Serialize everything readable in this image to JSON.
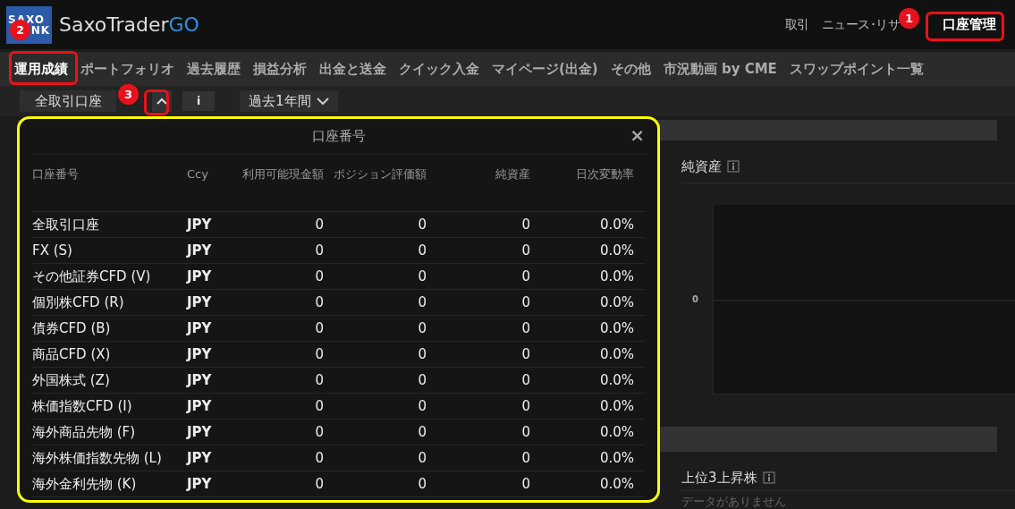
{
  "header": {
    "logo": [
      "SAXO",
      "NK"
    ],
    "app_name": "SaxoTrader",
    "app_name_accent": "GO",
    "nav": [
      {
        "label": "取引",
        "selected": false
      },
      {
        "label": "ニュース･リサ",
        "selected": false
      },
      {
        "label": "口座管理",
        "selected": true
      }
    ]
  },
  "tabs": [
    {
      "label": "運用成績",
      "selected": true
    },
    {
      "label": "ポートフォリオ",
      "selected": false
    },
    {
      "label": "過去履歴",
      "selected": false
    },
    {
      "label": "損益分析",
      "selected": false
    },
    {
      "label": "出金と送金",
      "selected": false
    },
    {
      "label": "クイック入金",
      "selected": false
    },
    {
      "label": "マイページ(出金)",
      "selected": false
    },
    {
      "label": "その他",
      "selected": false
    },
    {
      "label": "市況動画 by CME",
      "selected": false
    },
    {
      "label": "スワップポイント一覧",
      "selected": false
    }
  ],
  "filters": {
    "account": "全取引口座",
    "info": "i",
    "period": "過去1年間"
  },
  "modal": {
    "title": "口座番号",
    "close": "×",
    "columns": [
      "口座番号",
      "Ccy",
      "利用可能現金額",
      "ポジション評価額",
      "純資産",
      "日次変動率"
    ],
    "rows": [
      [
        "全取引口座",
        "JPY",
        "0",
        "0",
        "0",
        "0.0%"
      ],
      [
        "FX (S)",
        "JPY",
        "0",
        "0",
        "0",
        "0.0%"
      ],
      [
        "その他証券CFD (V)",
        "JPY",
        "0",
        "0",
        "0",
        "0.0%"
      ],
      [
        "個別株CFD (R)",
        "JPY",
        "0",
        "0",
        "0",
        "0.0%"
      ],
      [
        "債券CFD (B)",
        "JPY",
        "0",
        "0",
        "0",
        "0.0%"
      ],
      [
        "商品CFD (X)",
        "JPY",
        "0",
        "0",
        "0",
        "0.0%"
      ],
      [
        "外国株式 (Z)",
        "JPY",
        "0",
        "0",
        "0",
        "0.0%"
      ],
      [
        "株価指数CFD (I)",
        "JPY",
        "0",
        "0",
        "0",
        "0.0%"
      ],
      [
        "海外商品先物 (F)",
        "JPY",
        "0",
        "0",
        "0",
        "0.0%"
      ],
      [
        "海外株価指数先物 (L)",
        "JPY",
        "0",
        "0",
        "0",
        "0.0%"
      ],
      [
        "海外金利先物 (K)",
        "JPY",
        "0",
        "0",
        "0",
        "0.0%"
      ]
    ]
  },
  "panels": [
    {
      "title": "純資産",
      "y_label": "0"
    },
    {
      "title": "上位3上昇株",
      "empty_text": "データがありません"
    }
  ],
  "annotations": [
    {
      "number": "1"
    },
    {
      "number": "2"
    },
    {
      "number": "3"
    }
  ]
}
